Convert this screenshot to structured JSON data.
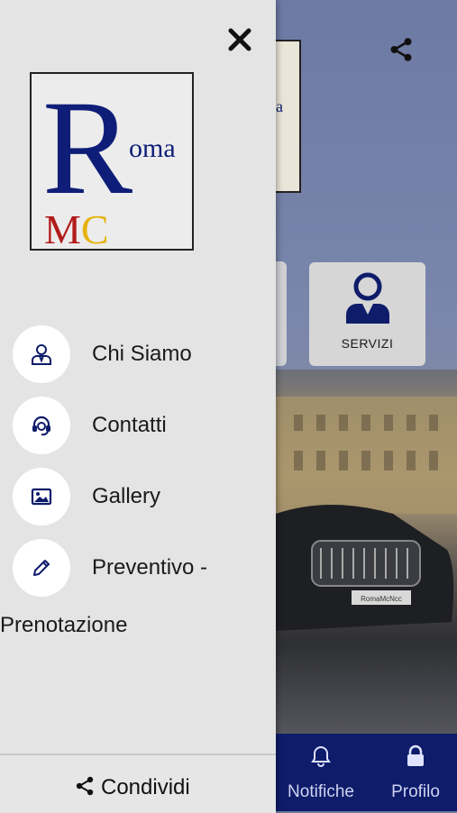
{
  "background": {
    "logo_fragment": "a",
    "tile_label": "SERVIZI",
    "tabs": [
      {
        "icon": "bell-icon",
        "label": "Notifiche"
      },
      {
        "icon": "lock-icon",
        "label": "Profilo"
      }
    ],
    "car_plate": "RomaMcNcc"
  },
  "drawer": {
    "logo": {
      "letter_r": "R",
      "oma": "oma",
      "mc": "MC"
    },
    "menu": [
      {
        "icon": "user-icon",
        "label": "Chi Siamo"
      },
      {
        "icon": "headset-icon",
        "label": "Contatti"
      },
      {
        "icon": "image-icon",
        "label": "Gallery"
      },
      {
        "icon": "pencil-icon",
        "label": "Preventivo -",
        "label_cont": "Prenotazione"
      }
    ],
    "footer": {
      "icon": "share-icon",
      "label": "Condividi"
    }
  },
  "colors": {
    "navy": "#0e1c6a",
    "drawer_bg": "#e4e4e4",
    "logo_blue": "#0e1e78",
    "logo_red": "#b31b1b",
    "logo_gold": "#e6b20a"
  }
}
